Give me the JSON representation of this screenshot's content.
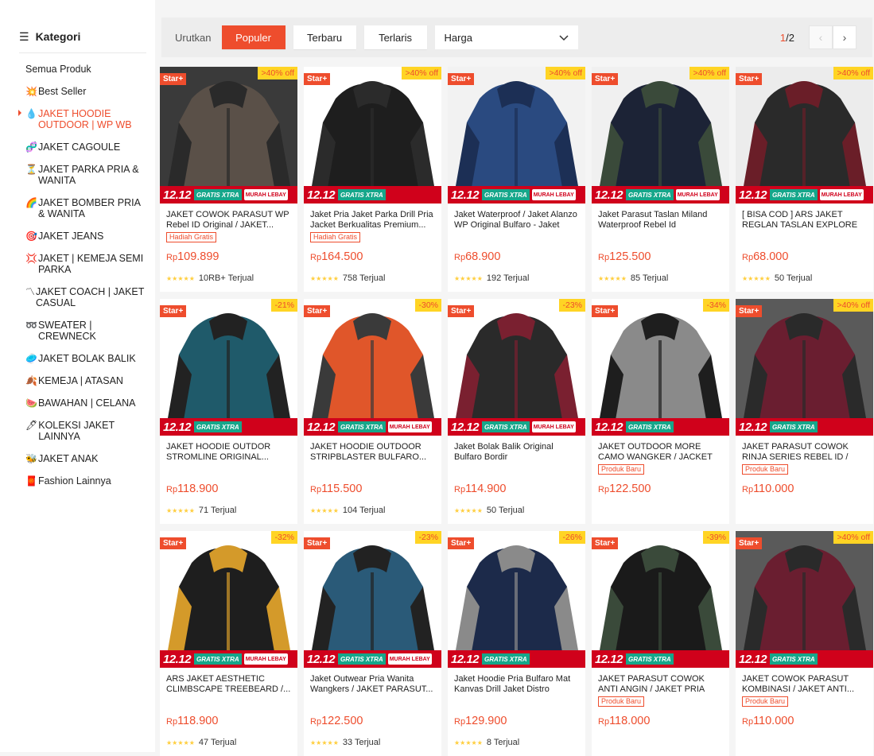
{
  "sidebar": {
    "header": "Kategori",
    "items": [
      {
        "icon": "",
        "label": "Semua Produk",
        "active": false
      },
      {
        "icon": "💥",
        "label": "Best Seller",
        "active": false
      },
      {
        "icon": "💧",
        "label": "JAKET HOODIE OUTDOOR | WP WB",
        "active": true
      },
      {
        "icon": "🧬",
        "label": "JAKET CAGOULE",
        "active": false
      },
      {
        "icon": "⏳",
        "label": "JAKET PARKA PRIA & WANITA",
        "active": false
      },
      {
        "icon": "🌈",
        "label": "JAKET BOMBER PRIA & WANITA",
        "active": false
      },
      {
        "icon": "🎯",
        "label": "JAKET JEANS",
        "active": false
      },
      {
        "icon": "💢",
        "label": "JAKET | KEMEJA SEMI PARKA",
        "active": false
      },
      {
        "icon": "〽",
        "label": "JAKET COACH | JAKET CASUAL",
        "active": false
      },
      {
        "icon": "➿",
        "label": "SWEATER | CREWNECK",
        "active": false
      },
      {
        "icon": "🥏",
        "label": "JAKET BOLAK BALIK",
        "active": false
      },
      {
        "icon": "🍂",
        "label": "KEMEJA | ATASAN",
        "active": false
      },
      {
        "icon": "🍉",
        "label": "BAWAHAN | CELANA",
        "active": false
      },
      {
        "icon": "🖊",
        "label": "KOLEKSI JAKET LAINNYA",
        "active": false
      },
      {
        "icon": "🐝",
        "label": "JAKET ANAK",
        "active": false
      },
      {
        "icon": "🧧",
        "label": "Fashion Lainnya",
        "active": false
      }
    ]
  },
  "sortbar": {
    "label": "Urutkan",
    "buttons": [
      "Populer",
      "Terbaru",
      "Terlaris"
    ],
    "select": "Harga",
    "page_current": "1",
    "page_total": "/2"
  },
  "promo": {
    "label": "12.12",
    "xtra": "GRATIS XTRA",
    "murah": "MURAH LEBAY"
  },
  "products": [
    {
      "name": "JAKET COWOK PARASUT WP Rebel ID Original / JAKET...",
      "tag": "Hadiah Gratis",
      "price": "109.899",
      "sold": "10RB+ Terjual",
      "disc": ">40% off",
      "murah": true,
      "colors": [
        "#3a3a3a",
        "#5a5048",
        "#2a2a2a"
      ]
    },
    {
      "name": "Jaket Pria Jaket Parka Drill Pria Jacket Berkualitas Premium...",
      "tag": "Hadiah Gratis",
      "price": "164.500",
      "sold": "758 Terjual",
      "disc": ">40% off",
      "murah": false,
      "colors": [
        "#ffffff",
        "#1e1e1e",
        "#2b2b2b"
      ]
    },
    {
      "name": "Jaket Waterproof / Jaket Alanzo WP Original Bulfaro - Jaket Anti...",
      "tag": "",
      "price": "68.900",
      "sold": "192 Terjual",
      "disc": ">40% off",
      "murah": true,
      "colors": [
        "#f2f2f2",
        "#2a4a80",
        "#1c2f55"
      ]
    },
    {
      "name": "Jaket Parasut Taslan Miland Waterproof Rebel Id",
      "tag": "",
      "price": "125.500",
      "sold": "85 Terjual",
      "disc": ">40% off",
      "murah": true,
      "colors": [
        "#f0f0f0",
        "#1c2336",
        "#3a4a3a"
      ]
    },
    {
      "name": "[ BISA COD ] ARS JAKET REGLAN TASLAN EXPLORE PRI...",
      "tag": "",
      "price": "68.000",
      "sold": "50 Terjual",
      "disc": ">40% off",
      "murah": true,
      "colors": [
        "#ececec",
        "#2a2a2a",
        "#6a1e28"
      ]
    },
    {
      "name": "JAKET HOODIE OUTDOR STROMLINE ORIGINAL...",
      "tag": "",
      "price": "118.900",
      "sold": "71 Terjual",
      "disc": "-21%",
      "murah": false,
      "colors": [
        "#ffffff",
        "#1f5a6a",
        "#222222"
      ]
    },
    {
      "name": "JAKET HOODIE OUTDOOR STRIPBLASTER BULFARO...",
      "tag": "",
      "price": "115.500",
      "sold": "104 Terjual",
      "disc": "-30%",
      "murah": true,
      "colors": [
        "#ffffff",
        "#e0562a",
        "#3a3a3a"
      ]
    },
    {
      "name": "Jaket Bolak Balik Original Bulfaro Bordir",
      "tag": "",
      "price": "114.900",
      "sold": "50 Terjual",
      "disc": "-23%",
      "murah": true,
      "colors": [
        "#ffffff",
        "#2a2a2a",
        "#7a2030"
      ]
    },
    {
      "name": "JAKET OUTDOOR MORE CAMO WANGKER / JACKET MORE...",
      "tag": "Produk Baru",
      "price": "122.500",
      "sold": "",
      "disc": "-34%",
      "murah": false,
      "colors": [
        "#ffffff",
        "#8a8a8a",
        "#1e1e1e"
      ]
    },
    {
      "name": "JAKET PARASUT COWOK RINJA SERIES REBEL ID / JAKET...",
      "tag": "Produk Baru",
      "price": "110.000",
      "sold": "",
      "disc": ">40% off",
      "murah": false,
      "colors": [
        "#5a5a5a",
        "#6a1e30",
        "#2a2a2a"
      ]
    },
    {
      "name": "ARS JAKET AESTHETIC CLIMBSCAPE TREEBEARD /...",
      "tag": "",
      "price": "118.900",
      "sold": "47 Terjual",
      "disc": "-32%",
      "murah": true,
      "colors": [
        "#ffffff",
        "#1e1e1e",
        "#d49a2a"
      ]
    },
    {
      "name": "Jaket Outwear Pria Wanita Wangkers / JAKET PARASUT...",
      "tag": "",
      "price": "122.500",
      "sold": "33 Terjual",
      "disc": "-23%",
      "murah": true,
      "colors": [
        "#ffffff",
        "#2a5a78",
        "#222222"
      ]
    },
    {
      "name": "Jaket Hoodie Pria Bulfaro Mat Kanvas Drill Jaket Distro Terbar...",
      "tag": "",
      "price": "129.900",
      "sold": "8 Terjual",
      "disc": "-26%",
      "murah": false,
      "colors": [
        "#ffffff",
        "#1c2a4a",
        "#8a8a8a"
      ]
    },
    {
      "name": "JAKET PARASUT COWOK ANTI ANGIN / JAKET PRIA WANGKE...",
      "tag": "Produk Baru",
      "price": "118.000",
      "sold": "",
      "disc": "-39%",
      "murah": false,
      "colors": [
        "#ffffff",
        "#1a1a1a",
        "#3a4a3a"
      ]
    },
    {
      "name": "JAKET COWOK PARASUT KOMBINASI / JAKET ANTI...",
      "tag": "Produk Baru",
      "price": "110.000",
      "sold": "",
      "disc": ">40% off",
      "murah": false,
      "colors": [
        "#5a5a5a",
        "#6a1e30",
        "#2a2a2a"
      ]
    }
  ],
  "star_label": "Star+",
  "currency": "Rp",
  "accent": "#ee4d2d"
}
